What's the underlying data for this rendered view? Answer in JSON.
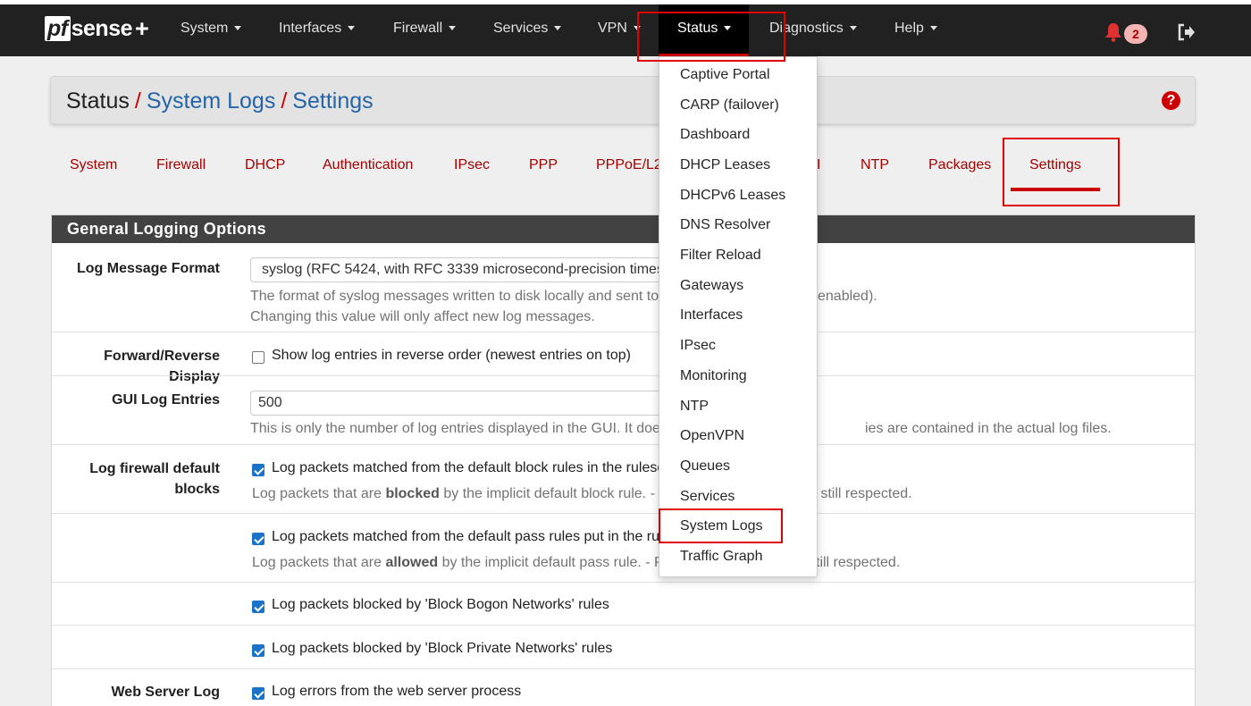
{
  "brand": {
    "prefix": "pf",
    "name": "sense",
    "suffix": "+"
  },
  "nav": {
    "items": [
      "System",
      "Interfaces",
      "Firewall",
      "Services",
      "VPN",
      "Status",
      "Diagnostics",
      "Help"
    ],
    "notification_count": "2"
  },
  "breadcrumb": {
    "root": "Status",
    "level1": "System Logs",
    "level2": "Settings",
    "separator": "/"
  },
  "tabs": [
    "System",
    "Firewall",
    "DHCP",
    "Authentication",
    "IPsec",
    "PPP",
    "PPPoE/L2",
    "I",
    "NTP",
    "Packages",
    "Settings"
  ],
  "status_menu": {
    "items": [
      "Captive Portal",
      "CARP (failover)",
      "Dashboard",
      "DHCP Leases",
      "DHCPv6 Leases",
      "DNS Resolver",
      "Filter Reload",
      "Gateways",
      "Interfaces",
      "IPsec",
      "Monitoring",
      "NTP",
      "OpenVPN",
      "Queues",
      "Services",
      "System Logs",
      "Traffic Graph"
    ]
  },
  "panel": {
    "title": "General Logging Options",
    "log_format": {
      "label": "Log Message Format",
      "value": "syslog (RFC 5424, with RFC 3339 microsecond-precision timestamps)",
      "help1_a": "The format of syslog messages written to disk locally and sent to",
      "help1_b": "enabled).",
      "help2": "Changing this value will only affect new log messages."
    },
    "reverse": {
      "label": "Forward/Reverse Display",
      "text": "Show log entries in reverse order (newest entries on top)"
    },
    "gui_entries": {
      "label": "GUI Log Entries",
      "value": "500",
      "help_a": "This is only the number of log entries displayed in the GUI. It does",
      "help_b": "ies are contained in the actual log files."
    },
    "default_blocks": {
      "label_line1": "Log firewall default",
      "label_line2": "blocks",
      "block_text": "Log packets matched from the default block rules in the rulese",
      "block_help_a": "Log packets that are ",
      "block_help_bold": "blocked",
      "block_help_b": " by the implicit default block rule. - Pe",
      "block_help_c": "e still respected.",
      "pass_text": "Log packets matched from the default pass rules put in the rul",
      "pass_help_a": "Log packets that are ",
      "pass_help_bold": "allowed",
      "pass_help_b": " by the implicit default pass rule. - Pe",
      "pass_help_c": "still respected.",
      "bogon_text": "Log packets blocked by 'Block Bogon Networks' rules",
      "private_text": "Log packets blocked by 'Block Private Networks' rules"
    },
    "web_server": {
      "label": "Web Server Log",
      "text": "Log errors from the web server process"
    }
  },
  "colors": {
    "navbar": "#212121",
    "accent": "#cc0000",
    "link": "#2464a8",
    "tab": "#a40000",
    "highlight": "#e00000"
  },
  "icons": {
    "bell": "bell-icon",
    "logout": "logout-icon",
    "help": "question-circle-icon"
  }
}
